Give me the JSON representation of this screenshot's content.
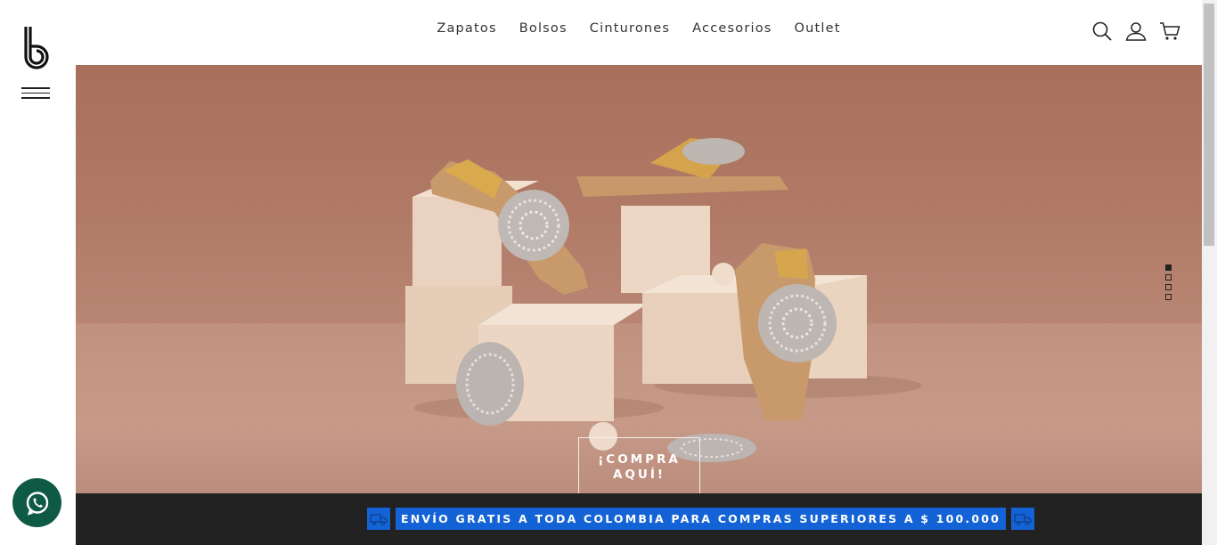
{
  "brand": {
    "logo_letter": "b"
  },
  "nav": {
    "items": [
      {
        "label": "Zapatos"
      },
      {
        "label": "Bolsos"
      },
      {
        "label": "Cinturones"
      },
      {
        "label": "Accesorios"
      },
      {
        "label": "Outlet"
      }
    ]
  },
  "header_icons": [
    "search-icon",
    "user-icon",
    "cart-icon"
  ],
  "hero": {
    "cta_line1": "¡COMPRA",
    "cta_line2": "AQUÍ!",
    "slides_total": 4,
    "active_slide": 1
  },
  "banner": {
    "text": "ENVÍO GRATIS A TODA COLOMBIA PARA COMPRAS SUPERIORES A $ 100.000",
    "color": "#1463d6"
  },
  "colors": {
    "whatsapp": "#0f5a44",
    "banner_bg": "#222222",
    "hero_bg": "#b07a66"
  }
}
